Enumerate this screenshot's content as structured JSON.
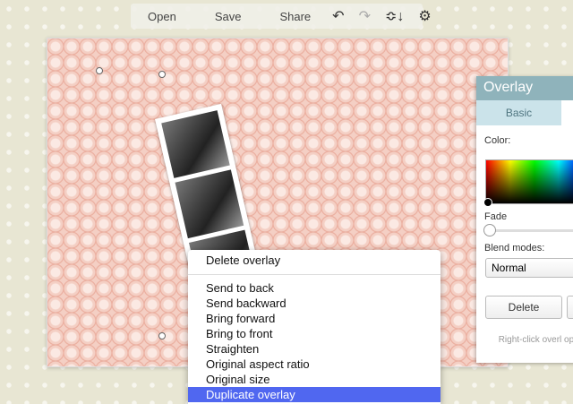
{
  "toolbar": {
    "open": "Open",
    "save": "Save",
    "share": "Share",
    "icons": [
      "undo-icon",
      "redo-icon",
      "layers-icon",
      "gear-icon"
    ]
  },
  "panel": {
    "title": "Overlay",
    "tab": "Basic",
    "color_label": "Color:",
    "fade_label": "Fade",
    "fade_value": 0,
    "blend_label": "Blend modes:",
    "blend_value": "Normal",
    "delete": "Delete",
    "hint": "Right-click overl option"
  },
  "menu": {
    "items": [
      "Delete overlay",
      "Send to back",
      "Send backward",
      "Bring forward",
      "Bring to front",
      "Straighten",
      "Original aspect ratio",
      "Original size",
      "Duplicate overlay"
    ],
    "highlight": "Duplicate overlay",
    "highlight_color": "#5067f0"
  }
}
